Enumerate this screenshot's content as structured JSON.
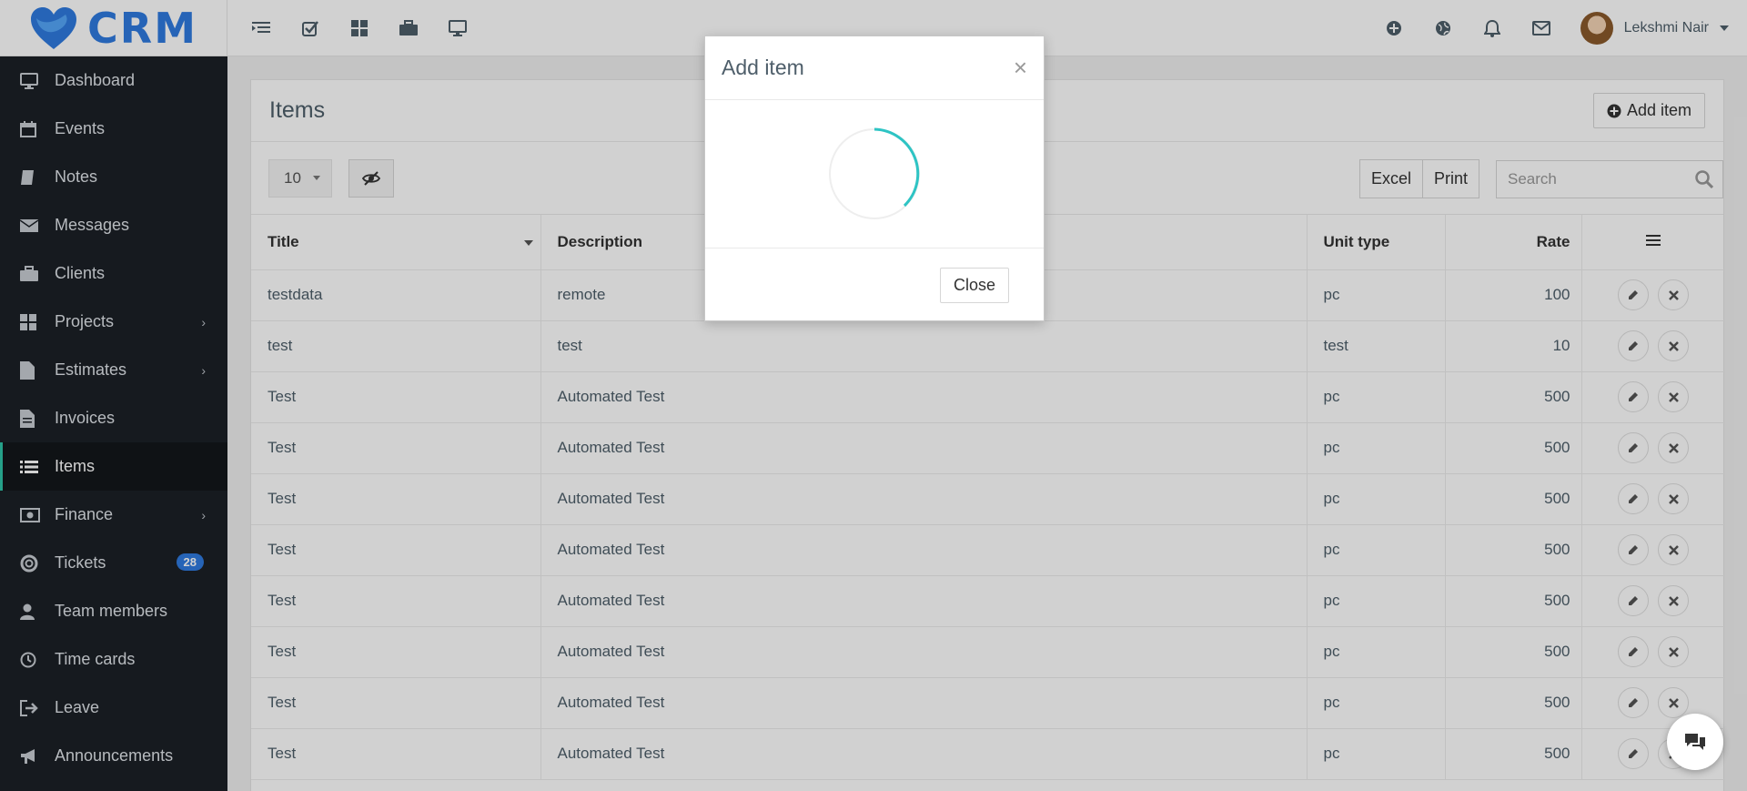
{
  "brand": {
    "logo_text": "CRM",
    "accent": "#2f7be0",
    "active_accent": "#2ec4a6"
  },
  "header": {
    "left_icons": [
      "menu-toggle-icon",
      "checkbox-icon",
      "grid-icon",
      "briefcase-icon",
      "monitor-icon"
    ],
    "right_icons": [
      "plus-circle-icon",
      "globe-icon",
      "bell-icon",
      "envelope-icon"
    ],
    "user_name": "Lekshmi Nair"
  },
  "sidebar": {
    "items": [
      {
        "label": "Dashboard",
        "icon": "monitor-icon"
      },
      {
        "label": "Events",
        "icon": "calendar-icon"
      },
      {
        "label": "Notes",
        "icon": "book-icon"
      },
      {
        "label": "Messages",
        "icon": "envelope-icon"
      },
      {
        "label": "Clients",
        "icon": "briefcase-icon"
      },
      {
        "label": "Projects",
        "icon": "grid-icon"
      },
      {
        "label": "Estimates",
        "icon": "file-icon"
      },
      {
        "label": "Invoices",
        "icon": "file-text-icon"
      },
      {
        "label": "Items",
        "icon": "list-icon"
      },
      {
        "label": "Finance",
        "icon": "money-icon"
      },
      {
        "label": "Tickets",
        "icon": "lifebuoy-icon",
        "badge": "28"
      },
      {
        "label": "Team members",
        "icon": "user-icon"
      },
      {
        "label": "Time cards",
        "icon": "clock-icon"
      },
      {
        "label": "Leave",
        "icon": "sign-out-icon"
      },
      {
        "label": "Announcements",
        "icon": "bullhorn-icon"
      }
    ]
  },
  "page": {
    "title": "Items",
    "add_button": "Add item",
    "page_size": "10",
    "excel_label": "Excel",
    "print_label": "Print",
    "search_placeholder": "Search"
  },
  "table": {
    "columns": [
      "Title",
      "Description",
      "Unit type",
      "Rate"
    ],
    "rows": [
      {
        "title": "testdata",
        "description": "remote",
        "unit": "pc",
        "rate": "100"
      },
      {
        "title": "test",
        "description": "test",
        "unit": "test",
        "rate": "10"
      },
      {
        "title": "Test",
        "description": "Automated Test",
        "unit": "pc",
        "rate": "500"
      },
      {
        "title": "Test",
        "description": "Automated Test",
        "unit": "pc",
        "rate": "500"
      },
      {
        "title": "Test",
        "description": "Automated Test",
        "unit": "pc",
        "rate": "500"
      },
      {
        "title": "Test",
        "description": "Automated Test",
        "unit": "pc",
        "rate": "500"
      },
      {
        "title": "Test",
        "description": "Automated Test",
        "unit": "pc",
        "rate": "500"
      },
      {
        "title": "Test",
        "description": "Automated Test",
        "unit": "pc",
        "rate": "500"
      },
      {
        "title": "Test",
        "description": "Automated Test",
        "unit": "pc",
        "rate": "500"
      },
      {
        "title": "Test",
        "description": "Automated Test",
        "unit": "pc",
        "rate": "500"
      }
    ]
  },
  "modal": {
    "title": "Add item",
    "close_label": "Close"
  }
}
